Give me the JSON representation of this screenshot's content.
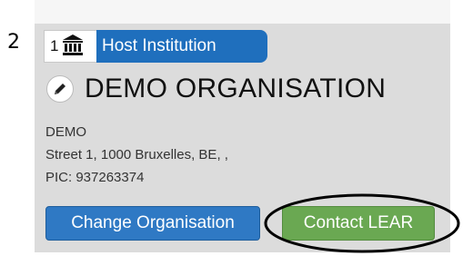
{
  "step_number": "2",
  "role": {
    "number": "1",
    "icon": "institution-icon",
    "label": "Host Institution"
  },
  "organisation": {
    "edit_icon": "pencil-icon",
    "name": "DEMO ORGANISATION",
    "short_name": "DEMO",
    "address": "Street 1, 1000 Bruxelles, BE, ,",
    "pic": "PIC: 937263374"
  },
  "actions": {
    "change_label": "Change Organisation",
    "contact_label": "Contact LEAR"
  },
  "colors": {
    "role_tag": "#1f6fbd",
    "change_button": "#2f79c4",
    "contact_button": "#6aa852",
    "panel": "#dcdcdc",
    "annotation": "#000000"
  }
}
